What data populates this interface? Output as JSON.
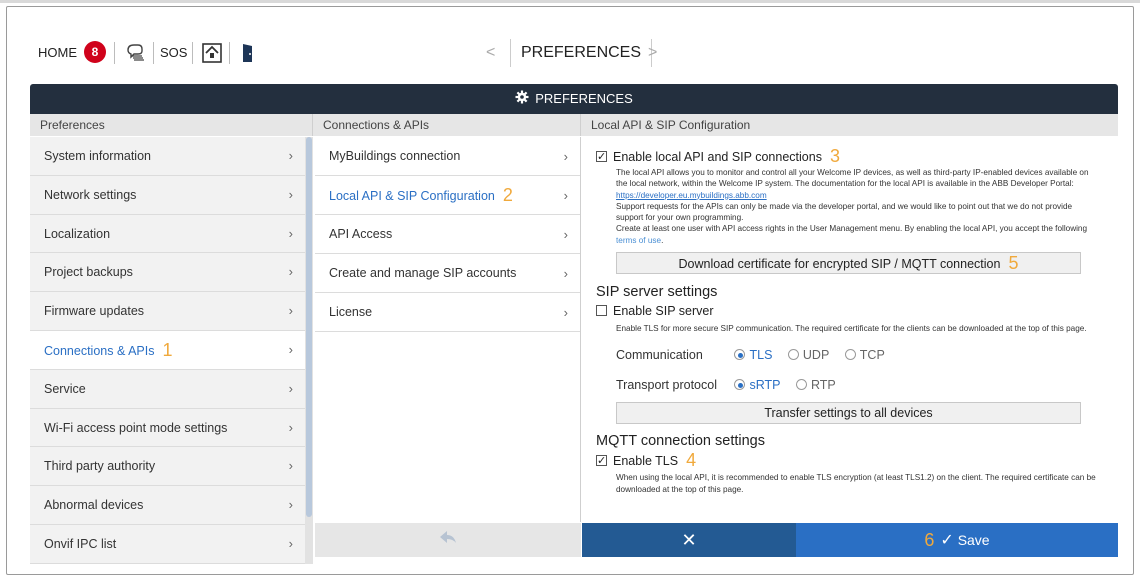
{
  "header": {
    "home_label": "HOME",
    "notification_count": "8",
    "sos_label": "SOS",
    "prev_arrow": "<",
    "page_title": "PREFERENCES",
    "next_arrow": ">"
  },
  "titlebar": {
    "title": "PREFERENCES"
  },
  "columns": {
    "left_header": "Preferences",
    "middle_header": "Connections & APIs",
    "right_header": "Local API & SIP Configuration"
  },
  "sidebar": {
    "items": [
      {
        "label": "System information"
      },
      {
        "label": "Network settings"
      },
      {
        "label": "Localization"
      },
      {
        "label": "Project backups"
      },
      {
        "label": "Firmware updates"
      },
      {
        "label": "Connections & APIs",
        "marker": "1"
      },
      {
        "label": "Service"
      },
      {
        "label": "Wi-Fi access point mode settings"
      },
      {
        "label": "Third party authority"
      },
      {
        "label": "Abnormal devices"
      },
      {
        "label": "Onvif IPC list"
      }
    ]
  },
  "middle": {
    "items": [
      {
        "label": "MyBuildings connection"
      },
      {
        "label": "Local API & SIP Configuration",
        "marker": "2"
      },
      {
        "label": "API Access"
      },
      {
        "label": "Create and manage SIP accounts"
      },
      {
        "label": "License"
      }
    ]
  },
  "right": {
    "enable_local_api": {
      "label": "Enable local API and SIP connections",
      "checked": true,
      "marker": "3"
    },
    "desc_p1": "The local API allows you to monitor and control all your Welcome IP devices, as well as third-party IP-enabled devices available on the local network, within the Welcome IP system. The documentation for the local API is available in the ABB Developer Portal: ",
    "desc_link": "https://developer.eu.mybuildings.abb.com",
    "desc_p2": "Support requests for the APIs can only be made via the developer portal, and we would like to point out that we do not provide support for your own programming.",
    "desc_p3": "Create at least one user with API access rights in the User Management menu. By enabling the local API, you accept the following ",
    "terms_link": "terms of use",
    "download_cert_label": "Download certificate for encrypted SIP / MQTT connection",
    "download_cert_marker": "5",
    "sip_section_title": "SIP server settings",
    "enable_sip": {
      "label": "Enable SIP server",
      "checked": false
    },
    "sip_desc": "Enable TLS for more secure SIP communication. The required certificate for the clients can be downloaded at the top of this page.",
    "communication_label": "Communication",
    "communication_options": [
      "TLS",
      "UDP",
      "TCP"
    ],
    "communication_selected": "TLS",
    "transport_label": "Transport protocol",
    "transport_options": [
      "sRTP",
      "RTP"
    ],
    "transport_selected": "sRTP",
    "transfer_label": "Transfer settings to all devices",
    "mqtt_section_title": "MQTT connection settings",
    "enable_tls": {
      "label": "Enable TLS",
      "checked": true,
      "marker": "4"
    },
    "mqtt_desc": "When using the local API, it is recommended to enable TLS encryption (at least TLS1.2) on the client. The required certificate can be downloaded at the top of this page."
  },
  "actions": {
    "cancel_symbol": "✕",
    "save_marker": "6",
    "save_label": "Save"
  },
  "colors": {
    "titlebar": "#232f3e",
    "accent": "#2a6fc4",
    "cancel": "#235a93",
    "marker": "#f0a93c",
    "badge": "#d0021b"
  }
}
